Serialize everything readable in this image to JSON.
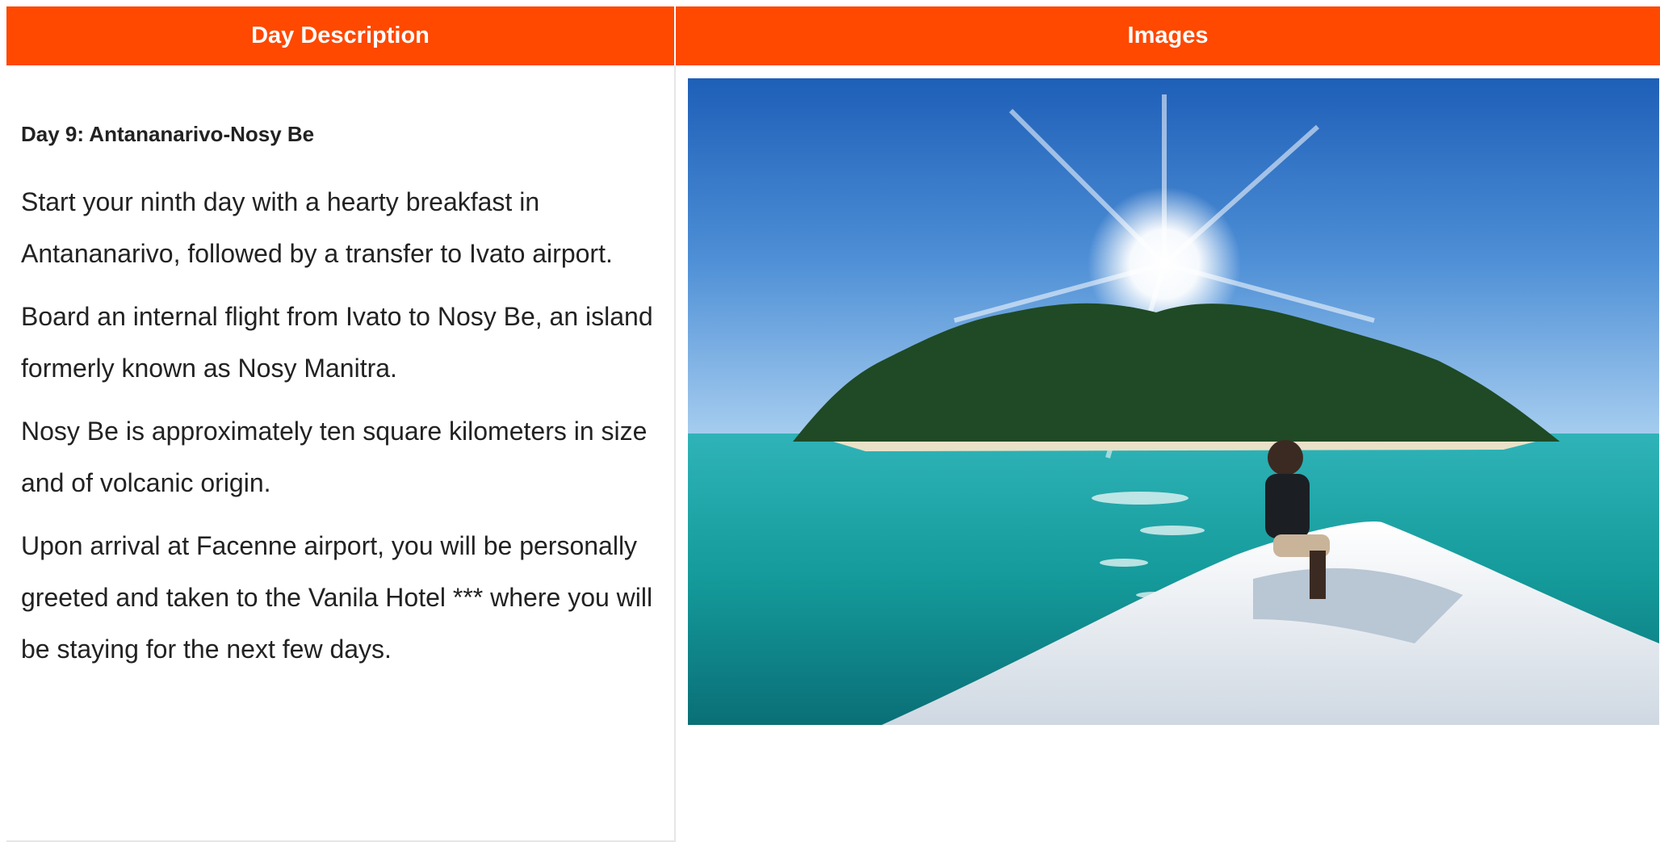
{
  "table": {
    "headers": [
      "Day Description",
      "Images"
    ],
    "day": {
      "title": "Day 9: Antananarivo-Nosy Be",
      "paragraphs": [
        "Start your ninth day with a hearty breakfast in Antananarivo, followed by a transfer to Ivato airport.",
        "Board an internal flight from Ivato to Nosy Be, an island formerly known as Nosy Manitra.",
        "Nosy Be is approximately ten square kilometers in size and of volcanic origin.",
        "Upon arrival at Facenne airport, you will be personally greeted and taken to the Vanila Hotel *** where you will be staying for the next few days."
      ]
    }
  },
  "colors": {
    "header_bg": "#ff4800",
    "header_text": "#ffffff",
    "body_text": "#222222",
    "border": "#e6e6e6"
  },
  "photo": {
    "subject": "island-boat-sun-photo"
  }
}
